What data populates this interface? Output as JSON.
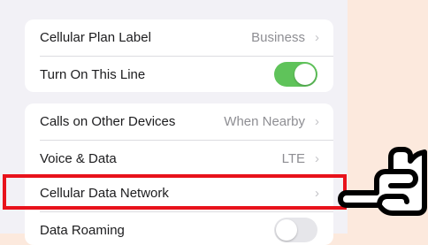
{
  "settings": {
    "group1": [
      {
        "label": "Cellular Plan Label",
        "value": "Business"
      },
      {
        "label": "Turn On This Line",
        "toggle": "on"
      }
    ],
    "group2": [
      {
        "label": "Calls on Other Devices",
        "value": "When Nearby"
      },
      {
        "label": "Voice & Data",
        "value": "LTE"
      },
      {
        "label": "Cellular Data Network",
        "value": ""
      },
      {
        "label": "Data Roaming",
        "toggle": "off"
      }
    ]
  },
  "icons": {
    "chevron": "chevron-right-icon",
    "pointer": "pointing-hand-icon"
  },
  "colors": {
    "highlight": "#e8121b",
    "toggle_on": "#5fc35a",
    "background": "#fce9dd"
  }
}
